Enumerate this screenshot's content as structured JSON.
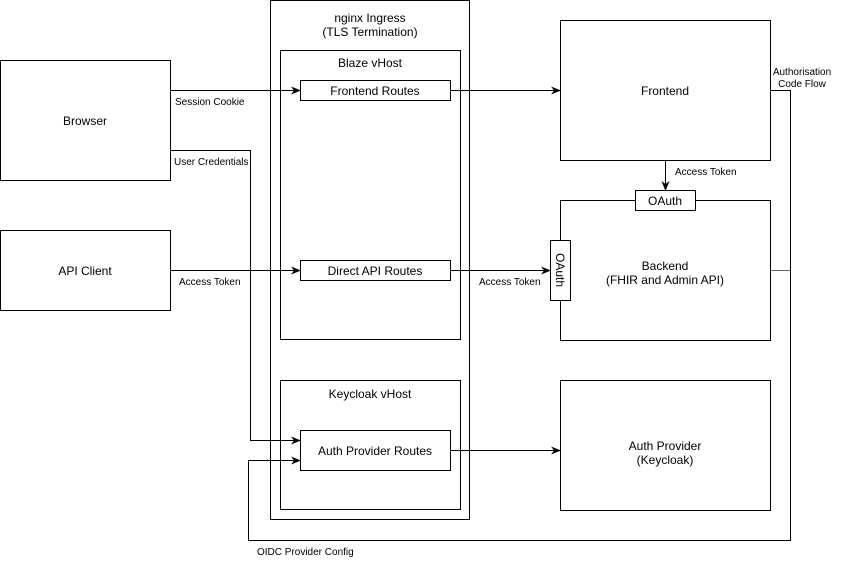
{
  "nodes": {
    "browser": "Browser",
    "api_client": "API Client",
    "nginx": {
      "line1": "nginx Ingress",
      "line2": "(TLS Termination)"
    },
    "blaze_vhost": "Blaze vHost",
    "frontend_routes": "Frontend Routes",
    "direct_api_routes": "Direct API Routes",
    "keycloak_vhost": "Keycloak vHost",
    "auth_provider_routes": "Auth Provider Routes",
    "frontend": "Frontend",
    "backend": {
      "line1": "Backend",
      "line2": "(FHIR and Admin API)"
    },
    "oauth_top": "OAuth",
    "oauth_left": "OAuth",
    "auth_provider": {
      "line1": "Auth Provider",
      "line2": "(Keycloak)"
    }
  },
  "edges": {
    "session_cookie": "Session Cookie",
    "user_credentials": "User Credentials",
    "api_access_token": "Access Token",
    "direct_access_token": "Access Token",
    "frontend_access_token": "Access Token",
    "auth_code_flow": {
      "line1": "Authorisation",
      "line2": "Code Flow"
    },
    "oidc_config": "OIDC Provider Config"
  }
}
